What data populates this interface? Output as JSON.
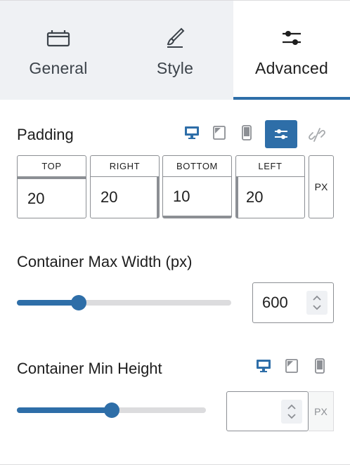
{
  "tabs": [
    {
      "label": "General",
      "icon": "toolbox-icon",
      "active": false
    },
    {
      "label": "Style",
      "icon": "brush-icon",
      "active": false
    },
    {
      "label": "Advanced",
      "icon": "sliders-icon",
      "active": true
    }
  ],
  "padding": {
    "label": "Padding",
    "fields": [
      {
        "label": "TOP",
        "value": "20"
      },
      {
        "label": "RIGHT",
        "value": "20"
      },
      {
        "label": "BOTTOM",
        "value": "10"
      },
      {
        "label": "LEFT",
        "value": "20"
      }
    ],
    "unit": "PX",
    "active_device": "desktop"
  },
  "max_width": {
    "label": "Container Max Width (px)",
    "value": "600",
    "slider_fraction": 0.29
  },
  "min_height": {
    "label": "Container Min Height",
    "value": "",
    "unit": "PX",
    "slider_fraction": 0.5,
    "active_device": "desktop"
  },
  "colors": {
    "accent": "#2e6ea8",
    "tab_bg": "#eff1f4",
    "border": "#8c8f94",
    "muted": "#8c8f94"
  }
}
